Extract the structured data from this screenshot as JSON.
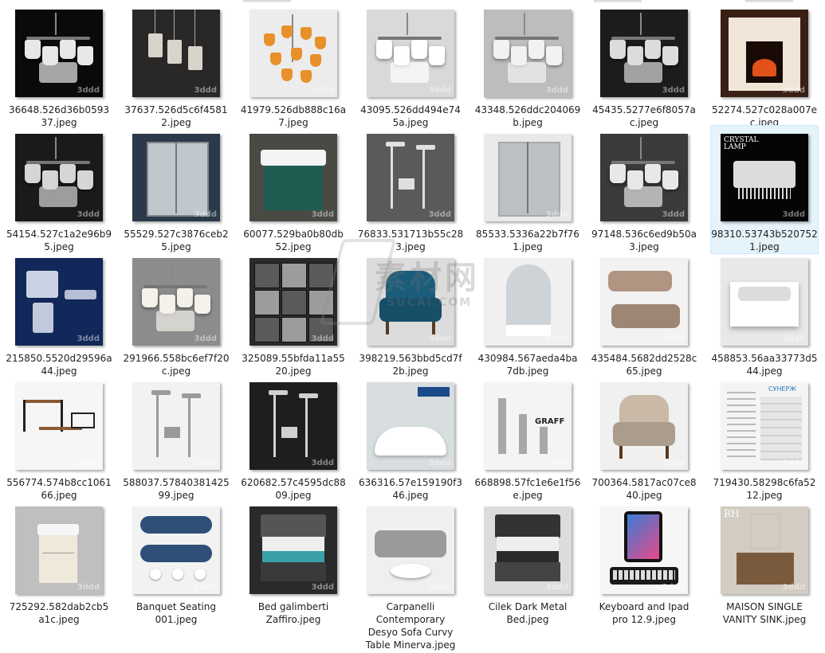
{
  "watermark": {
    "main": "素材网",
    "sub": "SUCAI.COM"
  },
  "files": [
    {
      "name": "36648.526d36b059337.jpeg",
      "l1": "36648.526d36b0593",
      "l2": "37.jpeg",
      "bg": "#0a0a0a",
      "accent": "#e8e8e8",
      "kind": "chandelier-dark"
    },
    {
      "name": "37637.526d5c6f45812.jpeg",
      "l1": "37637.526d5c6f4581",
      "l2": "2.jpeg",
      "bg": "#2a2826",
      "accent": "#d8d4cc",
      "kind": "pendants"
    },
    {
      "name": "41979.526db888c16a7.jpeg",
      "l1": "41979.526db888c16a",
      "l2": "7.jpeg",
      "bg": "#ececec",
      "accent": "#e8902a",
      "kind": "orange-chandelier"
    },
    {
      "name": "43095.526dd494e745a.jpeg",
      "l1": "43095.526dd494e74",
      "l2": "5a.jpeg",
      "bg": "#d9d9d9",
      "accent": "#ffffff",
      "kind": "chandelier-light"
    },
    {
      "name": "43348.526ddc204069b.jpeg",
      "l1": "43348.526ddc204069",
      "l2": "b.jpeg",
      "bg": "#bdbdbd",
      "accent": "#f2f2f2",
      "kind": "chandelier-light"
    },
    {
      "name": "45435.5277e6f8057ac.jpeg",
      "l1": "45435.5277e6f8057a",
      "l2": "c.jpeg",
      "bg": "#1c1c1c",
      "accent": "#dcdcdc",
      "kind": "chandelier-dark"
    },
    {
      "name": "52274.527c028a007ec.jpeg",
      "l1": "52274.527c028a007e",
      "l2": "c.jpeg",
      "bg": "#3a1f14",
      "accent": "#f0e6d8",
      "kind": "fireplace"
    },
    {
      "name": "54154.527c1a2e96b95.jpeg",
      "l1": "54154.527c1a2e96b9",
      "l2": "5.jpeg",
      "bg": "#1a1a1a",
      "accent": "#d6d6d6",
      "kind": "chandelier-dark"
    },
    {
      "name": "55529.527c3876ceb25.jpeg",
      "l1": "55529.527c3876ceb2",
      "l2": "5.jpeg",
      "bg": "#2b3a4a",
      "accent": "#e6ecef",
      "kind": "shower"
    },
    {
      "name": "60077.529ba0b80db52.jpeg",
      "l1": "60077.529ba0b80db",
      "l2": "52.jpeg",
      "bg": "#4a4a44",
      "accent": "#1f5c52",
      "kind": "basin"
    },
    {
      "name": "76833.531713b55c283.jpeg",
      "l1": "76833.531713b55c28",
      "l2": "3.jpeg",
      "bg": "#5a5a5a",
      "accent": "#e0e0e0",
      "kind": "shower-set"
    },
    {
      "name": "85533.5336a22b7f761.jpeg",
      "l1": "85533.5336a22b7f76",
      "l2": "1.jpeg",
      "bg": "#e9e9e9",
      "accent": "#b0b8ba",
      "kind": "shower"
    },
    {
      "name": "97148.536c6ed9b50a3.jpeg",
      "l1": "97148.536c6ed9b50a",
      "l2": "3.jpeg",
      "bg": "#3a3a3a",
      "accent": "#e8e8e8",
      "kind": "chandelier-dark"
    },
    {
      "name": "98310.53743b5207521.jpeg",
      "l1": "98310.53743b520752",
      "l2": "1.jpeg",
      "bg": "#050505",
      "accent": "#f4f4f4",
      "kind": "crystal",
      "selected": true,
      "label": "CRYSTAL LAMP"
    },
    {
      "name": "215850.5520d29596a44.jpeg",
      "l1": "215850.5520d29596a",
      "l2": "44.jpeg",
      "bg": "#12285a",
      "accent": "#dfe6f2",
      "kind": "crystal-blue"
    },
    {
      "name": "291966.558bc6ef7f20c.jpeg",
      "l1": "291966.558bc6ef7f20",
      "l2": "c.jpeg",
      "bg": "#8c8c8c",
      "accent": "#f4f1ea",
      "kind": "chandelier-light"
    },
    {
      "name": "325089.55bfda11a5520.jpeg",
      "l1": "325089.55bfda11a55",
      "l2": "20.jpeg",
      "bg": "#2a2a2a",
      "accent": "#9c9c9c",
      "kind": "grid"
    },
    {
      "name": "398219.563bbd5cd7f2b.jpeg",
      "l1": "398219.563bbd5cd7f",
      "l2": "2b.jpeg",
      "bg": "#dcdcdc",
      "accent": "#1b5c7a",
      "kind": "armchair-blue"
    },
    {
      "name": "430984.567aeda4ba7db.jpeg",
      "l1": "430984.567aeda4ba",
      "l2": "7db.jpeg",
      "bg": "#f0f0f0",
      "accent": "#c8ced2",
      "kind": "shower-cabin"
    },
    {
      "name": "435484.5682dd2528c65.jpeg",
      "l1": "435484.5682dd2528c",
      "l2": "65.jpeg",
      "bg": "#f2f2f2",
      "accent": "#b09582",
      "kind": "sofa"
    },
    {
      "name": "458853.56aa33773d544.jpeg",
      "l1": "458853.56aa33773d5",
      "l2": "44.jpeg",
      "bg": "#e8e8e8",
      "accent": "#ffffff",
      "kind": "basin-white"
    },
    {
      "name": "556774.574b8cc106166.jpeg",
      "l1": "556774.574b8cc1061",
      "l2": "66.jpeg",
      "bg": "#f6f6f6",
      "accent": "#8a5a32",
      "kind": "tables"
    },
    {
      "name": "588037.5784038142599.jpeg",
      "l1": "588037.57840381425",
      "l2": "99.jpeg",
      "bg": "#f2f2f2",
      "accent": "#9a9a9a",
      "kind": "shower-set-light"
    },
    {
      "name": "620682.57c4595dc8809.jpeg",
      "l1": "620682.57c4595dc88",
      "l2": "09.jpeg",
      "bg": "#1e1e1e",
      "accent": "#d0d0d0",
      "kind": "shower-set"
    },
    {
      "name": "636316.57e159190f346.jpeg",
      "l1": "636316.57e159190f3",
      "l2": "46.jpeg",
      "bg": "#d8dde0",
      "accent": "#ffffff",
      "kind": "bathtub"
    },
    {
      "name": "668898.57fc1e6e1f56e.jpeg",
      "l1": "668898.57fc1e6e1f56",
      "l2": "e.jpeg",
      "bg": "#f4f4f4",
      "accent": "#a8a8a8",
      "kind": "faucets",
      "label": "GRAFF"
    },
    {
      "name": "700364.5817ac07ce840.jpeg",
      "l1": "700364.5817ac07ce8",
      "l2": "40.jpeg",
      "bg": "#f0f0f0",
      "accent": "#c9b9a6",
      "kind": "armchair"
    },
    {
      "name": "719430.58298c6fa5212.jpeg",
      "l1": "719430.58298c6fa52",
      "l2": "12.jpeg",
      "bg": "#f4f4f4",
      "accent": "#c8c8c8",
      "kind": "towel-rail",
      "label": "СУНЕРЖ"
    },
    {
      "name": "725292.582dab2cb5a1c.jpeg",
      "l1": "725292.582dab2cb5",
      "l2": "a1c.jpeg",
      "bg": "#bfbfbf",
      "accent": "#efe9dc",
      "kind": "vanity"
    },
    {
      "name": "Banquet Seating 001.jpeg",
      "l1": "Banquet Seating",
      "l2": "001.jpeg",
      "bg": "#f2f2f2",
      "accent": "#2d4f78",
      "kind": "banquet"
    },
    {
      "name": "Bed galimberti Zaffiro.jpeg",
      "l1": "Bed galimberti",
      "l2": "Zaffiro.jpeg",
      "bg": "#2a2a2a",
      "accent": "#3aa0a8",
      "kind": "bed"
    },
    {
      "name": "Carpanelli Contemporary Desyo Sofa Curvy Table Minerva.jpeg",
      "l1": "Carpanelli",
      "l2": "Contemporary",
      "l3": "Desyo Sofa Curvy",
      "l4": "Table Minerva.jpeg",
      "bg": "#efefef",
      "accent": "#9a9a9a",
      "kind": "sofa-grey"
    },
    {
      "name": "Cilek Dark Metal Bed.jpeg",
      "l1": "Cilek Dark Metal",
      "l2": "Bed.jpeg",
      "bg": "#dcdcdc",
      "accent": "#2a2a2a",
      "kind": "bed-light"
    },
    {
      "name": "Keyboard and Ipad pro 12.9.jpeg",
      "l1": "Keyboard and Ipad",
      "l2": "pro 12.9.jpeg",
      "bg": "#f6f6f6",
      "accent": "#1a1a1a",
      "kind": "ipad"
    },
    {
      "name": "MAISON SINGLE VANITY SINK.jpeg",
      "l1": "MAISON SINGLE",
      "l2": "VANITY SINK.jpeg",
      "bg": "#d2ccc2",
      "accent": "#7a5a3c",
      "kind": "vanity-wood",
      "label": "RH"
    }
  ]
}
